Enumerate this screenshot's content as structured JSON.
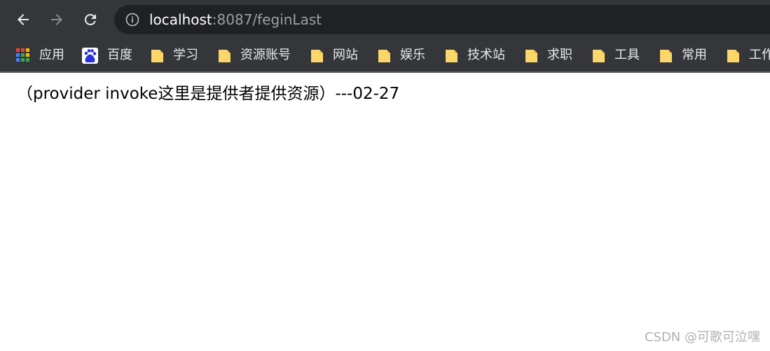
{
  "browser": {
    "url_host": "localhost",
    "url_rest": ":8087/feginLast",
    "bookmarks": [
      {
        "label": "应用",
        "icon": "apps-grid-icon"
      },
      {
        "label": "百度",
        "icon": "baidu-icon"
      },
      {
        "label": "学习",
        "icon": "folder-icon"
      },
      {
        "label": "资源账号",
        "icon": "folder-icon"
      },
      {
        "label": "网站",
        "icon": "folder-icon"
      },
      {
        "label": "娱乐",
        "icon": "folder-icon"
      },
      {
        "label": "技术站",
        "icon": "folder-icon"
      },
      {
        "label": "求职",
        "icon": "folder-icon"
      },
      {
        "label": "工具",
        "icon": "folder-icon"
      },
      {
        "label": "常用",
        "icon": "folder-icon"
      },
      {
        "label": "工作",
        "icon": "folder-icon"
      }
    ]
  },
  "page": {
    "body_text": "（provider invoke这里是提供者提供资源）---02-27"
  },
  "watermark": "CSDN @可歌可泣嘿",
  "colors": {
    "toolbar_bg": "#35363a",
    "omnibox_bg": "#202124",
    "folder_yellow": "#fbd66b"
  }
}
